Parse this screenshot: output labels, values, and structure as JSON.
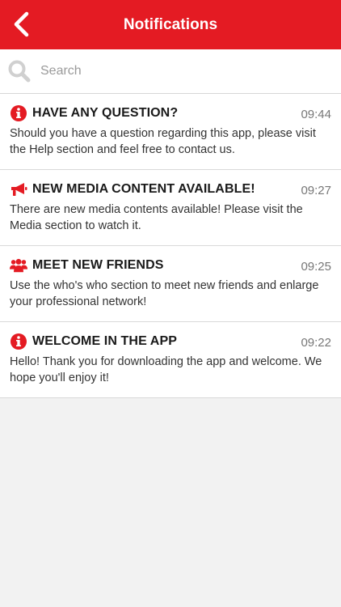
{
  "header": {
    "title": "Notifications",
    "back_icon": "chevron-left-icon"
  },
  "search": {
    "placeholder": "Search",
    "value": ""
  },
  "colors": {
    "brand": "#e41b23",
    "background": "#f2f2f2"
  },
  "notifications": [
    {
      "icon": "info-circle-icon",
      "title": "HAVE ANY QUESTION?",
      "time": "09:44",
      "body": "Should you have a question regarding this app, please visit the Help section and feel free to contact us."
    },
    {
      "icon": "megaphone-icon",
      "title": "NEW MEDIA CONTENT AVAILABLE!",
      "time": "09:27",
      "body": "There are new media contents available! Please visit the Media section to watch it."
    },
    {
      "icon": "users-icon",
      "title": "MEET NEW FRIENDS",
      "time": "09:25",
      "body": "Use the who's who section to meet new friends and enlarge your professional network!"
    },
    {
      "icon": "info-circle-icon",
      "title": "WELCOME IN THE APP",
      "time": "09:22",
      "body": "Hello! Thank you for downloading the app and welcome. We hope you'll enjoy it!"
    }
  ]
}
